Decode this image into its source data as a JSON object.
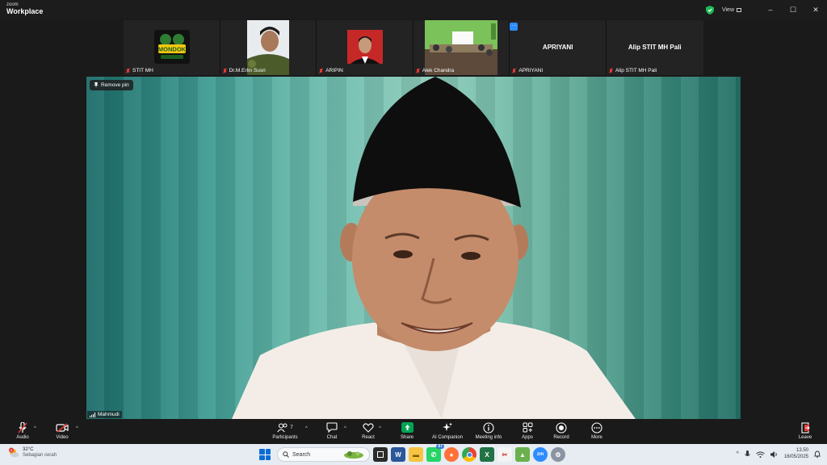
{
  "titlebar": {
    "brand_top": "zoom",
    "brand_bottom": "Workplace",
    "view_label": "View",
    "minimize": "–",
    "maximize": "☐",
    "close": "✕"
  },
  "participants_strip": [
    {
      "name": "STIT MH",
      "type": "image",
      "image_text": "MONDOK"
    },
    {
      "name": "Dr.M.Erlin Susri",
      "type": "photo"
    },
    {
      "name": "ARIPIN",
      "type": "photo"
    },
    {
      "name": "Alek Chandra",
      "type": "photo"
    },
    {
      "name": "APRIYANI",
      "type": "name",
      "big_name": "APRIYANI"
    },
    {
      "name": "Alip STIT MH Pali",
      "type": "name",
      "big_name": "Alip STIT MH Pali"
    }
  ],
  "main_video": {
    "remove_pin_label": "Remove pin",
    "speaker_name": "Mahmudi"
  },
  "toolbar": {
    "audio": "Audio",
    "video": "Video",
    "participants": "Participants",
    "participant_count": "7",
    "chat": "Chat",
    "react": "React",
    "share": "Share",
    "ai_companion": "AI Companion",
    "meeting_info": "Meeting info",
    "apps": "Apps",
    "record": "Record",
    "more": "More",
    "leave": "Leave"
  },
  "taskbar": {
    "weather_badge": "6",
    "temperature": "32°C",
    "weather_desc": "Sebagian cerah",
    "search_placeholder": "Search",
    "whatsapp_badge": "67",
    "time": "13.50",
    "date": "16/05/2025"
  },
  "colors": {
    "accent": "#2d8cff",
    "share_green": "#00a356",
    "mute_red": "#e53935"
  }
}
